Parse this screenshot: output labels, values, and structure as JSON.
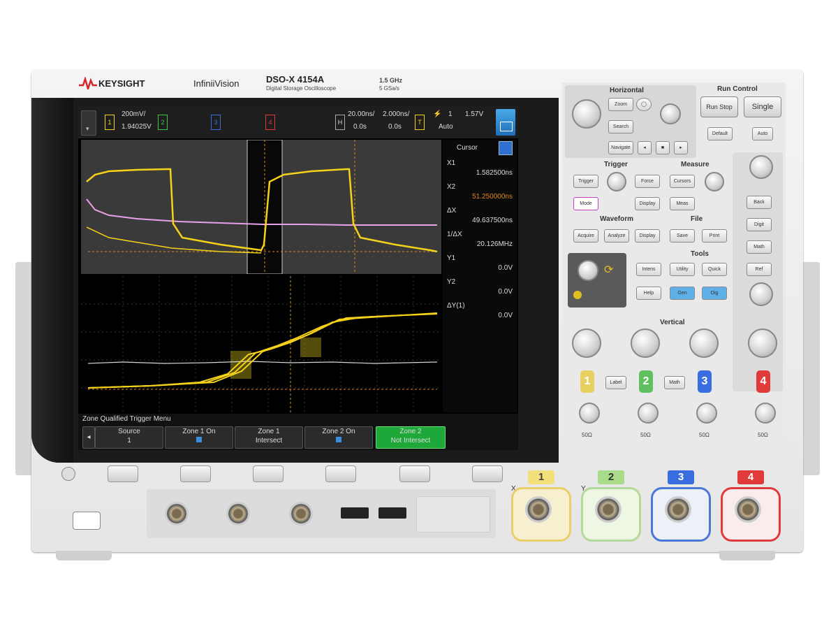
{
  "brand": {
    "logo_text": "KEYSIGHT",
    "series": "InfiniiVision",
    "model": "DSO-X 4154A",
    "model_sub": "Digital Storage Oscilloscope",
    "bandwidth": "1.5 GHz",
    "sample": "5 GSa/s",
    "logo_accent": "#d6262b"
  },
  "screen": {
    "ch1_scale": "200mV/",
    "ch1_offset": "1.94025V",
    "ch_tabs": [
      "1",
      "2",
      "3",
      "4"
    ],
    "timebase": "20.00ns/",
    "zoom_timebase": "2.000ns/",
    "delay": "0.0s",
    "delay2": "0.0s",
    "trigger_mode": "Auto",
    "trigger_level": "1",
    "trigger_value": "1.57V",
    "cursor_header": "Cursor",
    "cursors": [
      {
        "label": "X1",
        "value": "1.582500ns"
      },
      {
        "label": "X2",
        "value": "51.250000ns"
      },
      {
        "label": "ΔX",
        "value": "49.637500ns"
      },
      {
        "label": "1/ΔX",
        "value": "20.126MHz"
      },
      {
        "label": "Y1",
        "value": "0.0V"
      },
      {
        "label": "Y2",
        "value": "0.0V"
      },
      {
        "label": "ΔY(1)",
        "value": "0.0V"
      }
    ],
    "menu_title": "Zone Qualified Trigger Menu",
    "softkeys": [
      {
        "line1": "Source",
        "line2": "1"
      },
      {
        "line1": "Zone 1 On",
        "line2": ""
      },
      {
        "line1": "Zone 1",
        "line2": "Intersect"
      },
      {
        "line1": "Zone 2 On",
        "line2": ""
      },
      {
        "line1": "Zone 2",
        "line2": "Not Intersect"
      }
    ],
    "colors": {
      "ch1": "#f5d21a",
      "ch2": "#41c84a",
      "ch3": "#3a6ee0",
      "ch4": "#e03a3a",
      "math": "#e070e0"
    }
  },
  "panel": {
    "horizontal_title": "Horizontal",
    "run_control_title": "Run Control",
    "run_stop": "Run Stop",
    "single": "Single",
    "trigger_title": "Trigger",
    "measure_title": "Measure",
    "waveform_title": "Waveform",
    "file_title": "File",
    "tools_title": "Tools",
    "vertical_title": "Vertical",
    "vertical_channels": [
      "1",
      "2",
      "3",
      "4"
    ],
    "vertical_ohms": [
      "50Ω",
      "50Ω",
      "50Ω",
      "50Ω"
    ]
  },
  "front": {
    "channel_labels": [
      "1",
      "2",
      "3",
      "4"
    ],
    "x_label": "X",
    "y_label": "Y"
  }
}
